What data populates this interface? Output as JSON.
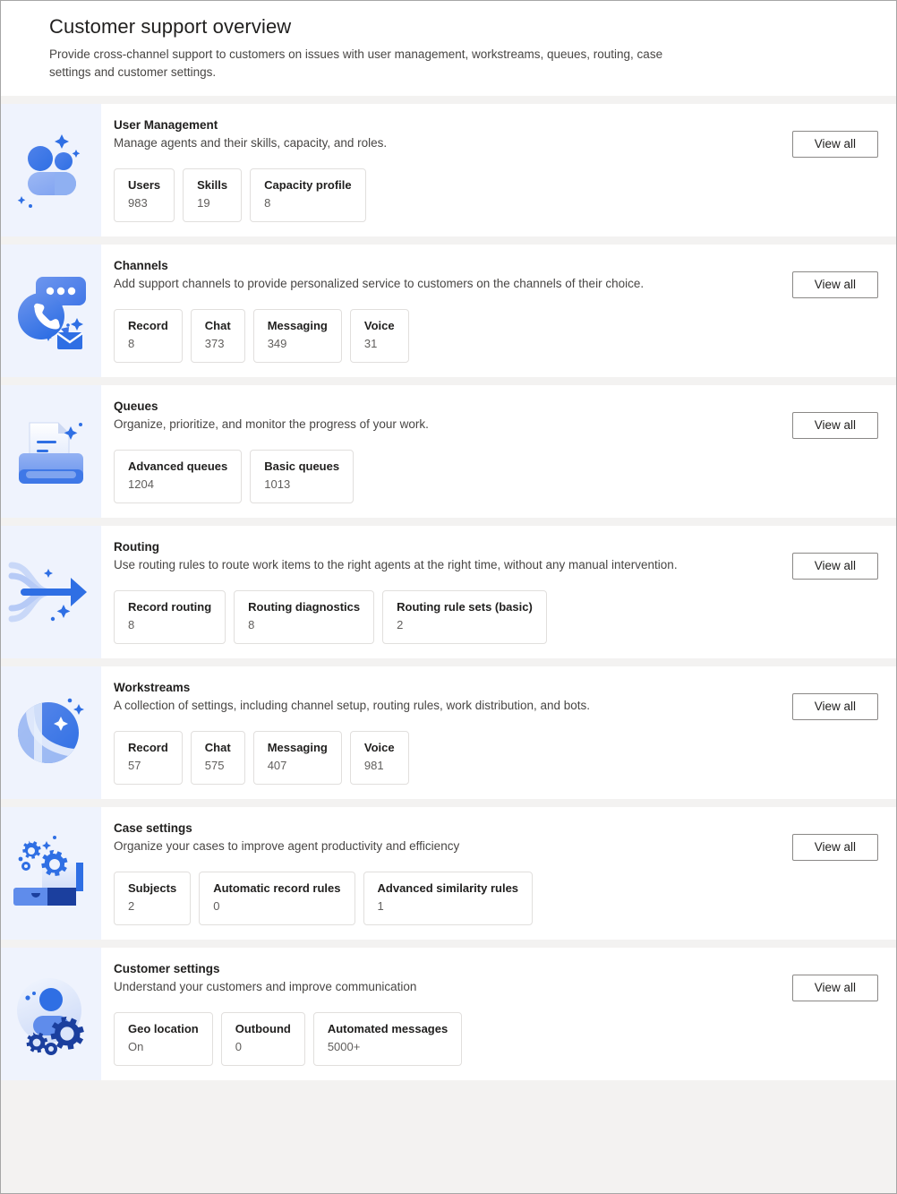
{
  "header": {
    "title": "Customer support overview",
    "subtitle": "Provide cross-channel support to customers on issues with user management, workstreams, queues, routing, case settings and customer settings."
  },
  "common": {
    "view_all_label": "View all"
  },
  "colors": {
    "icon_pane_background": "#eff3fd",
    "accent_blue": "#2f6fe4",
    "accent_blue_light": "#7b9ff0",
    "accent_blue_dark": "#1b3f9e",
    "page_background": "#f3f2f1",
    "card_background": "#ffffff",
    "tile_border": "#e1dfdd",
    "button_border": "#8a8886",
    "title_text": "#201f1e",
    "muted_text": "#605e5c"
  },
  "cards": [
    {
      "id": "user-management",
      "icon": "people-sparkle-icon",
      "title": "User Management",
      "description": "Manage agents and their skills, capacity, and roles.",
      "action_label": "View all",
      "stats": [
        {
          "label": "Users",
          "value": "983"
        },
        {
          "label": "Skills",
          "value": "19"
        },
        {
          "label": "Capacity profile",
          "value": "8"
        }
      ]
    },
    {
      "id": "channels",
      "icon": "chat-phone-mail-icon",
      "title": "Channels",
      "description": "Add support channels to provide personalized service to customers on the channels of their choice.",
      "action_label": "View all",
      "stats": [
        {
          "label": "Record",
          "value": "8"
        },
        {
          "label": "Chat",
          "value": "373"
        },
        {
          "label": "Messaging",
          "value": "349"
        },
        {
          "label": "Voice",
          "value": "31"
        }
      ]
    },
    {
      "id": "queues",
      "icon": "document-tray-icon",
      "title": "Queues",
      "description": "Organize, prioritize, and monitor the progress of your work.",
      "action_label": "View all",
      "stats": [
        {
          "label": "Advanced queues",
          "value": "1204"
        },
        {
          "label": "Basic queues",
          "value": "1013"
        }
      ]
    },
    {
      "id": "routing",
      "icon": "routing-arrow-icon",
      "title": "Routing",
      "description": "Use routing rules to route work items to the right agents at the right time, without any manual intervention.",
      "action_label": "View all",
      "stats": [
        {
          "label": "Record routing",
          "value": "8"
        },
        {
          "label": "Routing diagnostics",
          "value": "8"
        },
        {
          "label": "Routing rule sets (basic)",
          "value": "2"
        }
      ]
    },
    {
      "id": "workstreams",
      "icon": "sphere-ribbon-icon",
      "title": "Workstreams",
      "description": "A collection of settings, including channel setup, routing rules, work distribution, and bots.",
      "action_label": "View all",
      "stats": [
        {
          "label": "Record",
          "value": "57"
        },
        {
          "label": "Chat",
          "value": "575"
        },
        {
          "label": "Messaging",
          "value": "407"
        },
        {
          "label": "Voice",
          "value": "981"
        }
      ]
    },
    {
      "id": "case-settings",
      "icon": "briefcase-gears-icon",
      "title": "Case settings",
      "description": "Organize your cases to improve agent productivity and efficiency",
      "action_label": "View all",
      "stats": [
        {
          "label": "Subjects",
          "value": "2"
        },
        {
          "label": "Automatic record rules",
          "value": "0"
        },
        {
          "label": "Advanced similarity rules",
          "value": "1"
        }
      ]
    },
    {
      "id": "customer-settings",
      "icon": "person-gears-icon",
      "title": "Customer settings",
      "description": "Understand your customers and improve communication",
      "action_label": "View all",
      "stats": [
        {
          "label": "Geo location",
          "value": "On"
        },
        {
          "label": "Outbound",
          "value": "0"
        },
        {
          "label": "Automated messages",
          "value": "5000+"
        }
      ]
    }
  ]
}
